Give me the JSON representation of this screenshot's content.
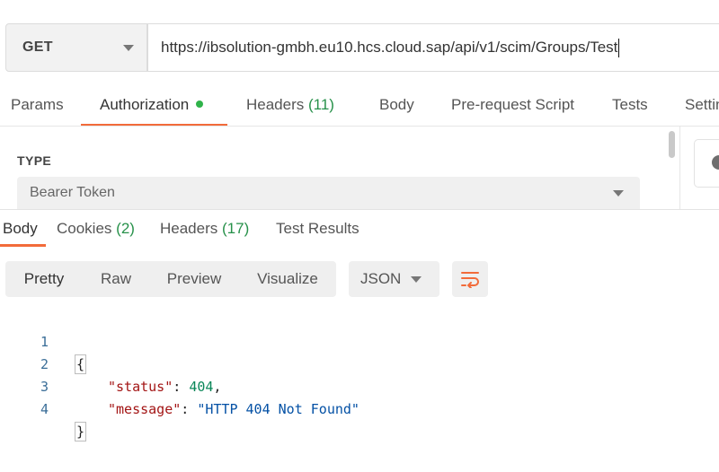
{
  "request": {
    "method": "GET",
    "url": "https://ibsolution-gmbh.eu10.hcs.cloud.sap/api/v1/scim/Groups/Test"
  },
  "request_tabs": [
    {
      "label": "Params",
      "count": ""
    },
    {
      "label": "Authorization",
      "count": ""
    },
    {
      "label": "Headers",
      "count": "(11)"
    },
    {
      "label": "Body",
      "count": ""
    },
    {
      "label": "Pre-request Script",
      "count": ""
    },
    {
      "label": "Tests",
      "count": ""
    },
    {
      "label": "Settin",
      "count": ""
    }
  ],
  "auth": {
    "type_label": "TYPE",
    "type_value": "Bearer Token"
  },
  "response_tabs": [
    {
      "label": "Body",
      "count": ""
    },
    {
      "label": "Cookies",
      "count": "(2)"
    },
    {
      "label": "Headers",
      "count": "(17)"
    },
    {
      "label": "Test Results",
      "count": ""
    }
  ],
  "view_modes": [
    "Pretty",
    "Raw",
    "Preview",
    "Visualize"
  ],
  "format": "JSON",
  "code_lines": [
    {
      "num": "1",
      "open": "{"
    },
    {
      "num": "2",
      "key": "\"status\"",
      "sep": ": ",
      "value": "404",
      "trail": ","
    },
    {
      "num": "3",
      "key": "\"message\"",
      "sep": ": ",
      "value": "\"HTTP 404 Not Found\"",
      "trail": ""
    },
    {
      "num": "4",
      "close": "}"
    }
  ],
  "colors": {
    "accent": "#f26b3a",
    "count_green": "#27914a",
    "auth_dot": "#2fb34a",
    "json_key": "#a31515",
    "json_number": "#098658",
    "json_string": "#0451a5",
    "line_number": "#3b6e98"
  },
  "icons": {
    "method_dropdown": "chevron-down-icon",
    "auth_status": "status-dot-icon",
    "auth_dropdown": "chevron-down-icon",
    "format_dropdown": "chevron-down-icon",
    "wrap": "wrap-lines-icon"
  }
}
